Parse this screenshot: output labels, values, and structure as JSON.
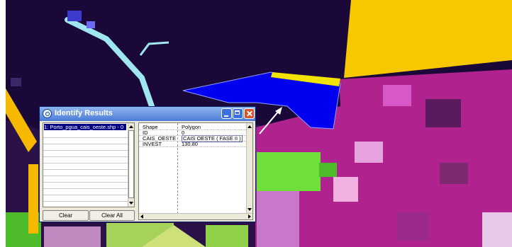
{
  "window": {
    "title": "Identify Results",
    "icon": "identify-icon",
    "controls": [
      "minimize-icon",
      "maximize-icon",
      "close-icon"
    ]
  },
  "features_list": {
    "selected_item": "1: Porto_pgua_cais_oeste.shp - 0"
  },
  "attributes": [
    {
      "field": "Shape",
      "value": "Polygon"
    },
    {
      "field": "ID",
      "value": "0"
    },
    {
      "field": "CAIS_OESTE",
      "value": "CAIS OESTE ( FASE II )"
    },
    {
      "field": "INVEST",
      "value": "130.80"
    }
  ],
  "buttons": {
    "clear": "Clear",
    "clear_all": "Clear All"
  },
  "colors": {
    "background_map": "#1A0838",
    "highlight_polygon": "#0000F0",
    "polygon_edge": "#F2E400",
    "yellow_area": "#F7C800",
    "light_blue_line": "#9FE6F0",
    "vegetation_green": "#6FE03A",
    "magenta": "#B0228E",
    "title_bar": "#4B7BD6",
    "selection": "#000080"
  }
}
